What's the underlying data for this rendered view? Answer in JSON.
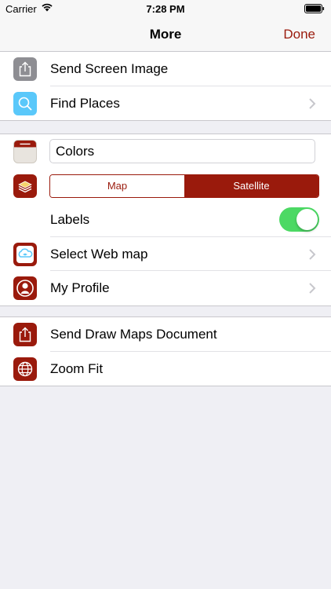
{
  "status": {
    "carrier": "Carrier",
    "time": "7:28 PM"
  },
  "nav": {
    "title": "More",
    "done_label": "Done"
  },
  "section1": [
    {
      "label": "Send Screen Image",
      "icon": "share-icon"
    },
    {
      "label": "Find Places",
      "icon": "magnifier-icon",
      "disclosure": true
    }
  ],
  "section2": {
    "colors_value": "Colors",
    "map_type": {
      "options": [
        "Map",
        "Satellite"
      ],
      "selected": "Satellite"
    },
    "labels": {
      "label": "Labels",
      "on": true
    },
    "web_map_label": "Select Web map",
    "profile_label": "My Profile"
  },
  "section3": [
    {
      "label": "Send Draw Maps Document",
      "icon": "share-icon"
    },
    {
      "label": "Zoom Fit",
      "icon": "globe-icon"
    }
  ],
  "colors": {
    "accent": "#9a1a0c",
    "toggle_on": "#4cd964"
  }
}
